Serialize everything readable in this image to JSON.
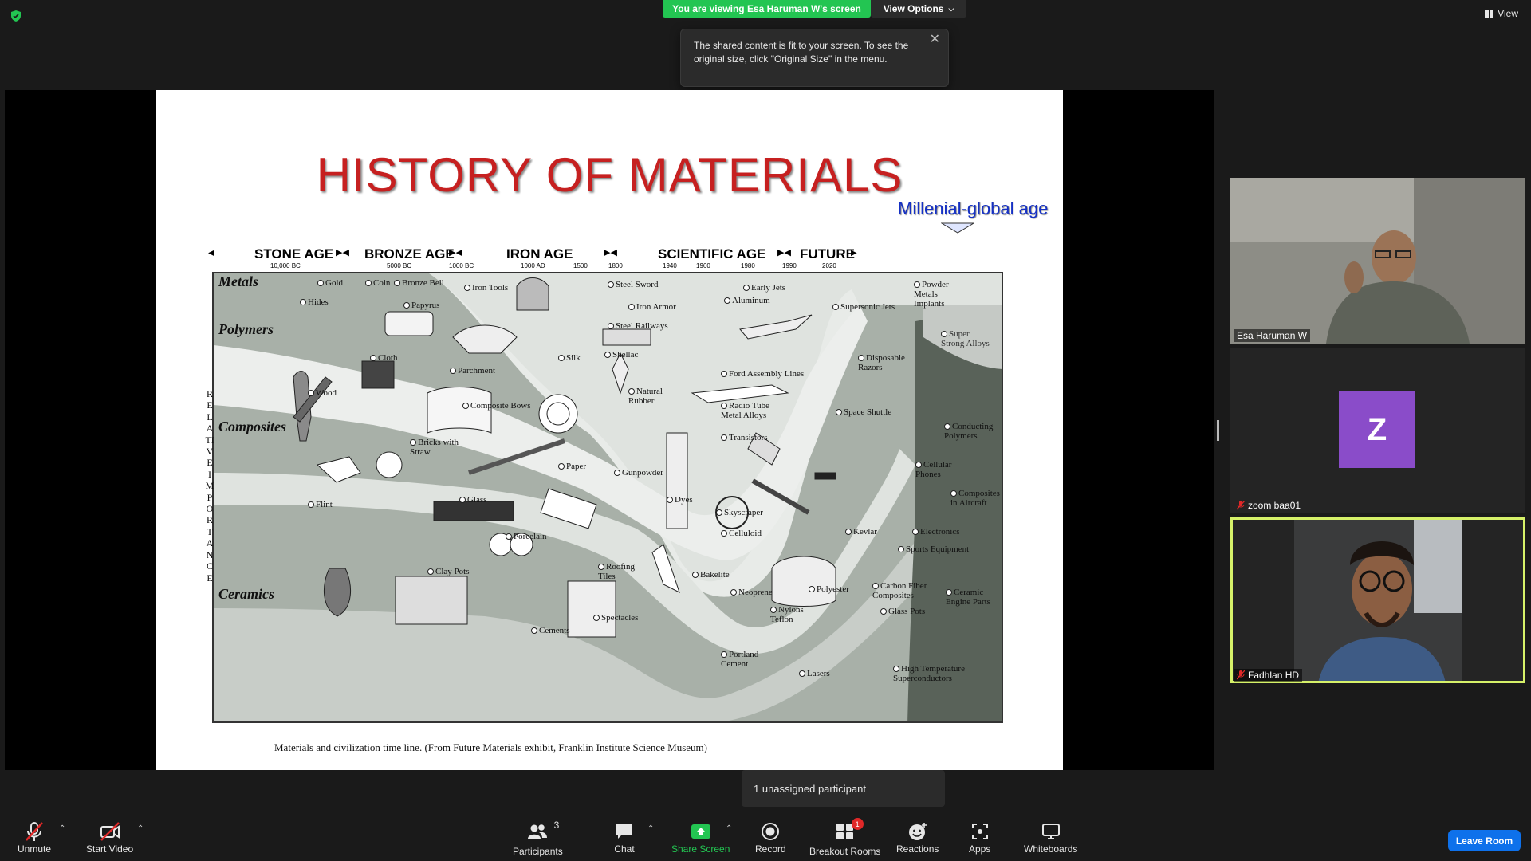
{
  "banner": {
    "viewing_text": "You are viewing Esa Haruman W's screen",
    "view_options_label": "View Options",
    "view_label": "View"
  },
  "tooltip": {
    "text": "The shared content is fit to your screen. To see the original size, click \"Original Size\" in the menu."
  },
  "slide": {
    "title": "HISTORY OF MATERIALS",
    "subtitle": "Millenial-global age",
    "ages": [
      "STONE AGE",
      "BRONZE AGE",
      "IRON AGE",
      "SCIENTIFIC AGE",
      "FUTURE"
    ],
    "dates": [
      "10,000 BC",
      "5000 BC",
      "1000 BC",
      "1000 AD",
      "1500",
      "1800",
      "1940",
      "1960",
      "1980",
      "1990",
      "2020"
    ],
    "rows": [
      "Metals",
      "Polymers",
      "Composites",
      "Ceramics"
    ],
    "vertical_label": "RELATIVE IMPORTANCE",
    "items": {
      "gold": "Gold",
      "coin": "Coin",
      "bronze_bell": "Bronze Bell",
      "iron_tools": "Iron Tools",
      "steel_sword": "Steel Sword",
      "early_jets": "Early Jets",
      "powder_metals": "Powder Metals Implants",
      "hides": "Hides",
      "papyrus": "Papyrus",
      "iron_armor": "Iron Armor",
      "aluminum": "Aluminum",
      "supersonic_jets": "Supersonic Jets",
      "steel_railways": "Steel Railways",
      "cloth": "Cloth",
      "silk": "Silk",
      "shellac": "Shellac",
      "parchment": "Parchment",
      "ford": "Ford Assembly Lines",
      "disposable_razors": "Disposable Razors",
      "super_strong_alloys": "Super Strong Alloys",
      "wood": "Wood",
      "composite_bows": "Composite Bows",
      "natural_rubber": "Natural Rubber",
      "radio_tube": "Radio Tube Metal Alloys",
      "space_shuttle": "Space Shuttle",
      "conducting_polymers": "Conducting Polymers",
      "bricks": "Bricks with Straw",
      "transistors": "Transistors",
      "paper": "Paper",
      "gunpowder": "Gunpowder",
      "cellular": "Cellular Phones",
      "flint": "Flint",
      "glass": "Glass",
      "dyes": "Dyes",
      "skyscraper": "Skyscraper",
      "composites_aircraft": "Composites in Aircraft",
      "celluloid": "Celluloid",
      "kevlar": "Kevlar",
      "electronics": "Electronics",
      "porcelain": "Porcelain",
      "sports_equipment": "Sports Equipment",
      "clay_pots": "Clay Pots",
      "roofing_tiles": "Roofing Tiles",
      "bakelite": "Bakelite",
      "polyester": "Polyester",
      "carbon_fiber": "Carbon Fiber Composites",
      "ceramic_engine": "Ceramic Engine Parts",
      "neoprene": "Neoprene",
      "nylons": "Nylons Teflon",
      "glass_pots": "Glass Pots",
      "cements": "Cements",
      "spectacles": "Spectacles",
      "portland": "Portland Cement",
      "lasers": "Lasers",
      "htsc": "High Temperature Superconductors"
    },
    "caption": "Materials and civilization time line. (From Future Materials exhibit, Franklin Institute Science Museum)"
  },
  "participants": [
    {
      "name": "Esa Haruman W",
      "muted": false
    },
    {
      "name": "zoom baa01",
      "muted": true,
      "initial": "Z",
      "avatar_color": "#8a4cc9"
    },
    {
      "name": "Fadhlan HD",
      "muted": true
    }
  ],
  "unassigned_text": "1 unassigned participant",
  "toolbar": {
    "unmute": "Unmute",
    "start_video": "Start Video",
    "participants": "Participants",
    "participants_count": "3",
    "chat": "Chat",
    "share_screen": "Share Screen",
    "record": "Record",
    "breakout_rooms": "Breakout Rooms",
    "breakout_badge": "1",
    "reactions": "Reactions",
    "apps": "Apps",
    "whiteboards": "Whiteboards",
    "leave_room": "Leave Room"
  },
  "colors": {
    "green": "#23c552",
    "accent": "#0e71eb",
    "active_border": "#d6f169",
    "title_red": "#c62020",
    "subtitle_blue": "#1530c4"
  }
}
